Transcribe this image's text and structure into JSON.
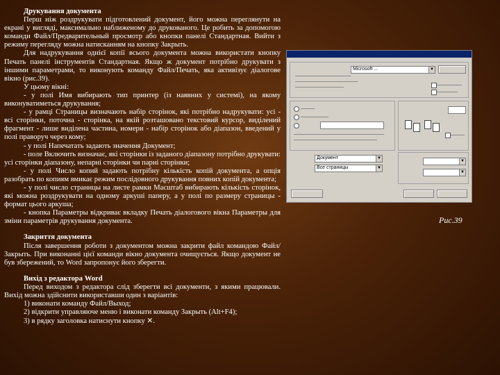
{
  "section_print": {
    "heading": "Друкування документа",
    "p1": "Перш ніж роздрукувати підготовлений документ, його можна переглянути на екрані у вигляді, максимально наближеному до друкованого. Це робить за допомогою команди Файл/Предварительный просмотр або кнопки панелі Стандартная. Вийти з режиму перегляду можна натисканням на кнопку Закрыть.",
    "p2": "Для надрукування однієї копії всього документа можна використати кнопку Печать панелі інструментів Стандартная. Якщо ж документ потрібно друкувати з іншими параметрами, то виконують команду Файл/Печать, яка активізує діалогове вікно (рис.39).",
    "p3": "У цьому вікні:",
    "items": [
      "- у полі Имя вибирають тип принтер (із наявних у системі), на якому виконуватиметься друкування;",
      "- у рамці Страницы визначають набір сторінок, які потрібно надрукувати: усі - всі сторінки, поточна - сторінка, на якій розташовано текстовий курсор, виділений фрагмент - лише виділена частина, номери - набір сторінок або діапазон, введений у полі праворуч через кому;",
      "- у полі Напечатать задають значення Документ;",
      "- поле Включить визначає, які сторінки із заданого діапазону потрібно друкувати: усі сторінки діапазону, непарні сторінки чи парні сторінки;",
      "- у полі Число копий задають потрібну кількість копій документа, а опція разобрать по копиям вмикає режим послідовного друкування повних копій документа;",
      "- у полі число страницы на листе рамки Масштаб вибирають кількість сторінок, які можна роздрукувати на одному аркуші паперу, а у полі по размеру страницы - формат цього аркуша;",
      "- кнопка Параметры відкриває вкладку Печать діалогового вікна Параметры для зміни параметрів друкування документа."
    ]
  },
  "section_close": {
    "heading": "Закриття документа",
    "p1": "Після завершення роботи з документом можна закрити файл командою Файл/Закрыть. При виконанні цієї команди вікно документа очищується. Якщо документ не був збережений, то Word запропонує його зберегти."
  },
  "section_exit": {
    "heading": "Вихід з редактора Word",
    "p1": "Перед виходом з редактора слід зберегти всі документи, з якими працювали. Вихід можна здійснити використавши один з варіантів:",
    "options": [
      "1) виконати команду Файл/Выход;",
      "2) відкрити управляюче меню і виконати команду Закрыть (Alt+F4);",
      "3) в рядку заголовка натиснути кнопку"
    ],
    "close_glyph": "✕",
    "option_suffix": "."
  },
  "figure": {
    "caption": "Рис.39",
    "dialog_title": "",
    "field_printer": "Microsoft ...",
    "field_print_what": "Документ",
    "field_include": "Все страницы"
  }
}
